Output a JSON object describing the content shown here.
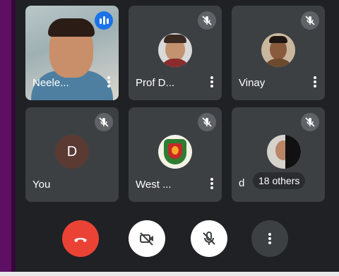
{
  "participants": {
    "tile1": {
      "name": "Neele..."
    },
    "tile2": {
      "name": "Prof D..."
    },
    "tile3": {
      "name": "Vinay"
    },
    "tile4": {
      "name": "You",
      "avatar_letter": "D"
    },
    "tile5": {
      "name": "West ..."
    },
    "tile6": {
      "name": "d",
      "others_label": "18 others"
    }
  },
  "colors": {
    "end_call": "#ea4335",
    "controls": "#ffffff",
    "speaking": "#1a73e8",
    "tile": "#3c4043",
    "background": "#202124"
  },
  "icons": {
    "end_call": "phone-hangup-icon",
    "camera": "camera-off-icon",
    "mic": "mic-off-icon",
    "more": "more-vert-icon",
    "speaking": "audio-level-icon"
  }
}
